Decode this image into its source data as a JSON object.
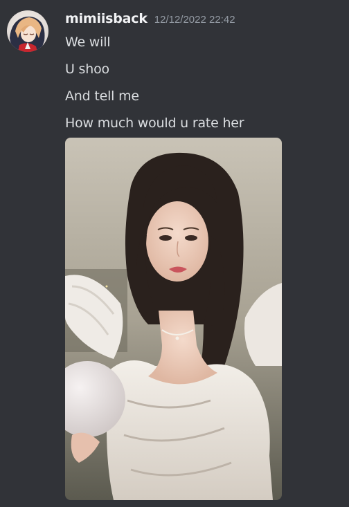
{
  "message": {
    "author": "mimiisback",
    "timestamp": "12/12/2022 22:42",
    "lines": [
      "We will",
      "U shoo",
      "And tell me",
      "How much would u rate her"
    ]
  },
  "icons": {
    "avatar": "anime-avatar-image",
    "attachment": "photo-attachment"
  },
  "colors": {
    "background": "#313338",
    "username": "#f2f3f5",
    "timestamp": "#949ba4",
    "text": "#dbdee1"
  }
}
